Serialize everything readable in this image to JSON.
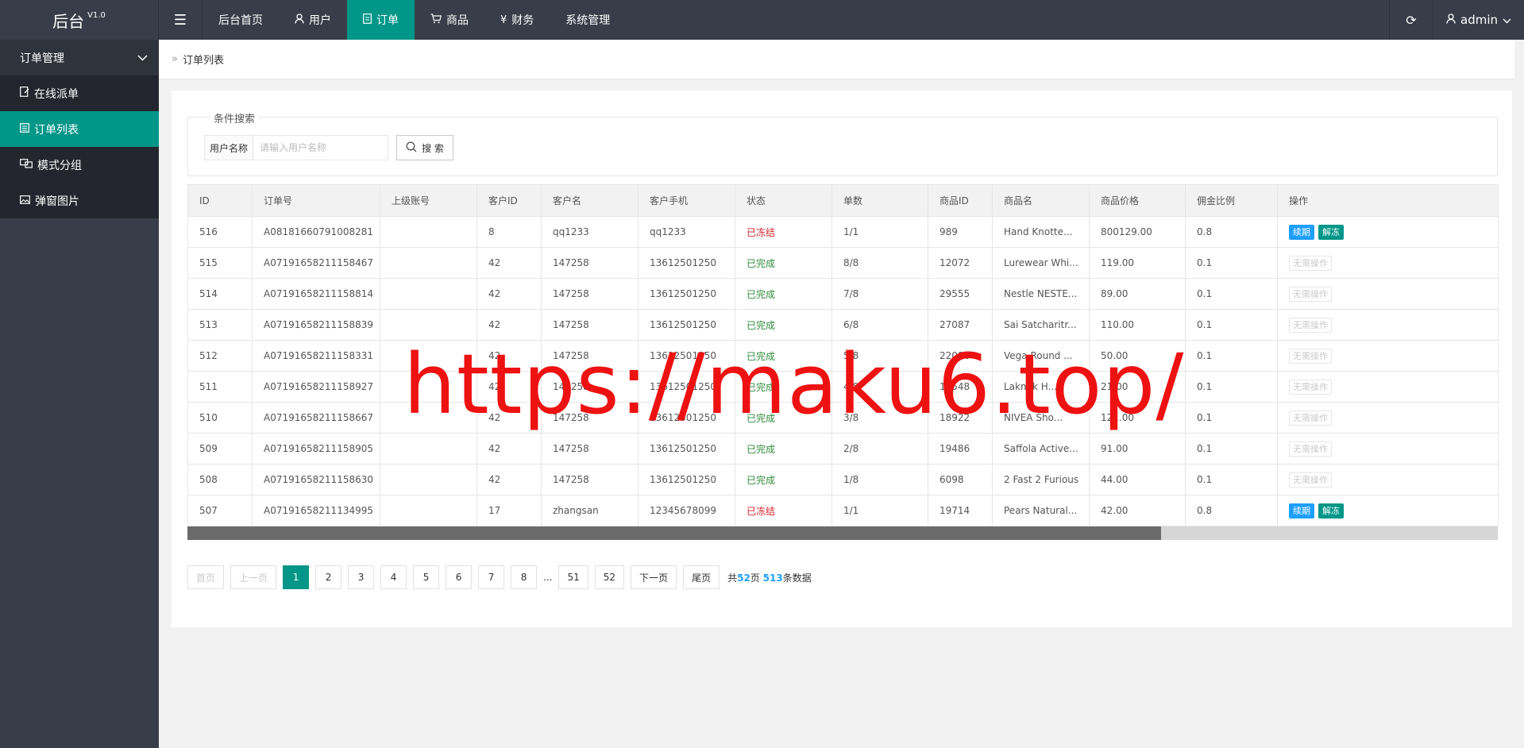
{
  "header": {
    "logo": "后台",
    "version": "V1.0",
    "menu_toggle_icon": "hamburger-icon",
    "nav": [
      {
        "label": "后台首页",
        "icon": "",
        "active": false
      },
      {
        "label": "用户",
        "icon": "user-icon",
        "active": false
      },
      {
        "label": "订单",
        "icon": "document-icon",
        "active": true
      },
      {
        "label": "商品",
        "icon": "cart-icon",
        "active": false
      },
      {
        "label": "财务",
        "icon": "yen-icon",
        "active": false
      },
      {
        "label": "系统管理",
        "icon": "",
        "active": false
      }
    ],
    "refresh_icon": "refresh-icon",
    "user": "admin"
  },
  "sidebar": {
    "group": "订单管理",
    "items": [
      {
        "label": "在线派单",
        "icon": "edit-icon",
        "active": false
      },
      {
        "label": "订单列表",
        "icon": "list-icon",
        "active": true
      },
      {
        "label": "模式分组",
        "icon": "group-icon",
        "active": false
      },
      {
        "label": "弹窗图片",
        "icon": "image-icon",
        "active": false
      }
    ]
  },
  "breadcrumb": {
    "current": "订单列表"
  },
  "search": {
    "legend": "条件搜索",
    "label": "用户名称",
    "placeholder": "请输入用户名称",
    "button": "搜 索"
  },
  "table": {
    "headers": [
      "ID",
      "订单号",
      "上级账号",
      "客户ID",
      "客户名",
      "客户手机",
      "状态",
      "单数",
      "商品ID",
      "商品名",
      "商品价格",
      "佣金比例",
      "操作"
    ],
    "rows": [
      {
        "id": "516",
        "order_no": "A08181660791008281",
        "parent": "",
        "cust_id": "8",
        "cust_name": "qq1233",
        "phone": "qq1233",
        "status": "已冻结",
        "status_type": "frozen",
        "count": "1/1",
        "goods_id": "989",
        "goods_name": "Hand Knotte...",
        "price": "800129.00",
        "commission": "0.8",
        "actions": [
          "续期",
          "解冻"
        ]
      },
      {
        "id": "515",
        "order_no": "A07191658211158467",
        "parent": "",
        "cust_id": "42",
        "cust_name": "147258",
        "phone": "13612501250",
        "status": "已完成",
        "status_type": "done",
        "count": "8/8",
        "goods_id": "12072",
        "goods_name": "Lurewear Whi...",
        "price": "119.00",
        "commission": "0.1",
        "actions": [
          "无需操作"
        ]
      },
      {
        "id": "514",
        "order_no": "A07191658211158814",
        "parent": "",
        "cust_id": "42",
        "cust_name": "147258",
        "phone": "13612501250",
        "status": "已完成",
        "status_type": "done",
        "count": "7/8",
        "goods_id": "29555",
        "goods_name": "Nestle NESTE...",
        "price": "89.00",
        "commission": "0.1",
        "actions": [
          "无需操作"
        ]
      },
      {
        "id": "513",
        "order_no": "A07191658211158839",
        "parent": "",
        "cust_id": "42",
        "cust_name": "147258",
        "phone": "13612501250",
        "status": "已完成",
        "status_type": "done",
        "count": "6/8",
        "goods_id": "27087",
        "goods_name": "Sai Satcharitr...",
        "price": "110.00",
        "commission": "0.1",
        "actions": [
          "无需操作"
        ]
      },
      {
        "id": "512",
        "order_no": "A07191658211158331",
        "parent": "",
        "cust_id": "42",
        "cust_name": "147258",
        "phone": "13612501250",
        "status": "已完成",
        "status_type": "done",
        "count": "5/8",
        "goods_id": "22096",
        "goods_name": "Vega Round ...",
        "price": "50.00",
        "commission": "0.1",
        "actions": [
          "无需操作"
        ]
      },
      {
        "id": "511",
        "order_no": "A07191658211158927",
        "parent": "",
        "cust_id": "42",
        "cust_name": "147258",
        "phone": "13612501250",
        "status": "已完成",
        "status_type": "done",
        "count": "4/8",
        "goods_id": "18548",
        "goods_name": "Lakmik H...",
        "price": "21.00",
        "commission": "0.1",
        "actions": [
          "无需操作"
        ]
      },
      {
        "id": "510",
        "order_no": "A07191658211158667",
        "parent": "",
        "cust_id": "42",
        "cust_name": "147258",
        "phone": "13612501250",
        "status": "已完成",
        "status_type": "done",
        "count": "3/8",
        "goods_id": "18922",
        "goods_name": "NIVEA Sho...",
        "price": "121.00",
        "commission": "0.1",
        "actions": [
          "无需操作"
        ]
      },
      {
        "id": "509",
        "order_no": "A07191658211158905",
        "parent": "",
        "cust_id": "42",
        "cust_name": "147258",
        "phone": "13612501250",
        "status": "已完成",
        "status_type": "done",
        "count": "2/8",
        "goods_id": "19486",
        "goods_name": "Saffola Active...",
        "price": "91.00",
        "commission": "0.1",
        "actions": [
          "无需操作"
        ]
      },
      {
        "id": "508",
        "order_no": "A07191658211158630",
        "parent": "",
        "cust_id": "42",
        "cust_name": "147258",
        "phone": "13612501250",
        "status": "已完成",
        "status_type": "done",
        "count": "1/8",
        "goods_id": "6098",
        "goods_name": "2 Fast 2 Furious",
        "price": "44.00",
        "commission": "0.1",
        "actions": [
          "无需操作"
        ]
      },
      {
        "id": "507",
        "order_no": "A07191658211134995",
        "parent": "",
        "cust_id": "17",
        "cust_name": "zhangsan",
        "phone": "12345678099",
        "status": "已冻结",
        "status_type": "frozen",
        "count": "1/1",
        "goods_id": "19714",
        "goods_name": "Pears Natural...",
        "price": "42.00",
        "commission": "0.8",
        "actions": [
          "续期",
          "解冻"
        ]
      }
    ]
  },
  "pagination": {
    "first": "首页",
    "prev": "上一页",
    "pages": [
      "1",
      "2",
      "3",
      "4",
      "5",
      "6",
      "7",
      "8"
    ],
    "current": "1",
    "ellipsis": "...",
    "tail_pages": [
      "51",
      "52"
    ],
    "next": "下一页",
    "last": "尾页",
    "info_prefix": "共",
    "total_pages": "52",
    "info_pages_suffix": "页",
    "total_records": "513",
    "info_records_suffix": "条数据"
  },
  "watermark": "https://maku6.top/",
  "colors": {
    "accent": "#009688",
    "header_bg": "#393d49",
    "sidebar_bg": "#23262e",
    "blue": "#1e9fff",
    "frozen": "#d4242b",
    "done": "#2e8b3a"
  }
}
